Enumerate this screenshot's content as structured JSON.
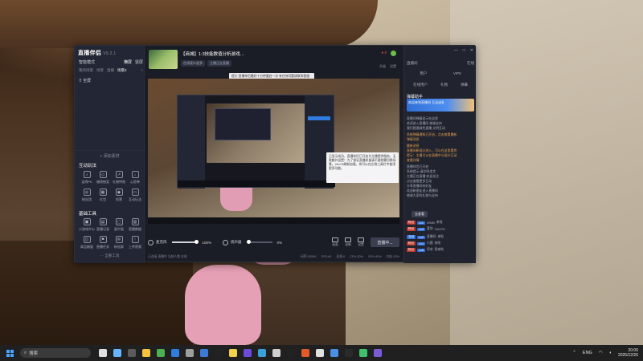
{
  "app": {
    "name": "直播伴侣",
    "version": "V9.2.1",
    "mode": "智能模式",
    "mode_right": "横屏",
    "mode_right2": "竖屏",
    "tabs": [
      "我的场景",
      "场景",
      "直播",
      "场景2"
    ],
    "add_tab": "+",
    "scene_item": "全屏",
    "add_source": "添加素材",
    "interaction_title": "互动玩法",
    "interaction_tools": [
      {
        "icon": "mic-icon",
        "label": "连线PK"
      },
      {
        "icon": "shield-icon",
        "label": "福袋抽奖"
      },
      {
        "icon": "rocket-icon",
        "label": "礼物特效"
      },
      {
        "icon": "download-icon",
        "label": "心愿单"
      },
      {
        "icon": "cup-icon",
        "label": "粉丝团"
      },
      {
        "icon": "grid-icon",
        "label": "红包"
      },
      {
        "icon": "target-icon",
        "label": "投票"
      },
      {
        "icon": "tv-icon",
        "label": "互动玩法"
      }
    ],
    "basic_title": "基础工具",
    "basic_tools": [
      {
        "icon": "gift-icon",
        "label": "小游戏中心"
      },
      {
        "icon": "doc-icon",
        "label": "直播记录"
      },
      {
        "icon": "pip-icon",
        "label": "画中画"
      },
      {
        "icon": "chart-icon",
        "label": "直播数据"
      },
      {
        "icon": "cart-icon",
        "label": "商品橱窗"
      },
      {
        "icon": "flag-icon",
        "label": "直播任务"
      },
      {
        "icon": "mail-icon",
        "label": "粉丝群"
      },
      {
        "icon": "upload-icon",
        "label": "上传视频"
      }
    ],
    "more_tools": "全部工具"
  },
  "stream": {
    "title": "【商城】1:3技能数值分析游戏…",
    "tags": [
      "在线观众超多",
      "主播正在直播"
    ],
    "user_links": [
      "升级",
      "设置"
    ],
    "notice": "8",
    "stats": [
      "流畅",
      "GPU",
      "内存",
      "CPU"
    ],
    "tooltip": "提示 直播伴侣最好十分钟重启一次 有任何问题请联系客服"
  },
  "popup_text": "已显示成功，直播伴侣已开启为主播提供服务，无需额外设置！为了保证直播质量请不要频繁切换场景，Ctrl+R刷新加载，你可以在左侧工具栏中使用更多功能。",
  "controls": {
    "mic_label": "麦克风",
    "mic_value": "100%",
    "speaker_label": "扬声器",
    "speaker_value": "0%",
    "mini": [
      "画面",
      "录制",
      "设置"
    ],
    "live_button": "直播中..."
  },
  "status_bar": {
    "left": "已连接 直播中 当前人数 在线",
    "items": [
      "码率:3000K",
      "FPS:60",
      "丢帧:0",
      "CPU:20%",
      "GPU:40%",
      "内存:32%"
    ]
  },
  "right_panel": {
    "header_left": "直播间",
    "header_right": "在线",
    "window_controls": [
      "—",
      "□",
      "✕"
    ],
    "tabs1": [
      "用户",
      "VIP5"
    ],
    "tabs2": [
      "在线用户",
      "礼物",
      "弹幕"
    ],
    "title": "弹幕助手",
    "banner": "欢迎来到直播间 互动送礼",
    "lines": [
      "直播间弹幕显示在这里",
      "欢迎进入直播间 感谢支持",
      "我们提倡绿色直播 文明互动",
      "直播伴侣已开启",
      "系统提示:请文明发言",
      "主播正在直播 欢迎关注",
      "点击查看更多互动",
      "分享直播间给好友",
      "欢迎新朋友进入直播间",
      "感谢大家的礼物与支持"
    ],
    "highlight_lines": [
      "系统弹幕通知已开启，点击查看最新",
      "弹幕消息",
      "最新消息",
      "直播间新观众进入，可以在这里看到",
      "提示：主播可以在直播中与观众互动",
      "查看详情"
    ],
    "button": "去查看",
    "chats": [
      {
        "badge": "粉丝",
        "badge_color": "#c0392b",
        "level": "Lv1",
        "name": "WMM",
        "text": "来啦"
      },
      {
        "badge": "粉丝",
        "badge_color": "#c0392b",
        "level": "Lv3",
        "name": "爱你",
        "text": "GAGTK"
      },
      {
        "badge": "互动",
        "badge_color": "#2f6fd8",
        "level": "Lv2",
        "name": "直播间",
        "text": "来啦"
      },
      {
        "badge": "粉丝",
        "badge_color": "#c0392b",
        "level": "Lv1",
        "name": "小鹿",
        "text": "来啦"
      },
      {
        "badge": "粉丝",
        "badge_color": "#c0392b",
        "level": "Lv5",
        "name": "阿宅",
        "text": "我来啦"
      }
    ]
  },
  "taskbar": {
    "search": "搜索",
    "app_colors": [
      "#e0e0e0",
      "#6ab4ff",
      "#5b5b5b",
      "#f5c242",
      "#4caf50",
      "#2f7be0",
      "#9e9e9e",
      "#3d7ad6",
      "#222",
      "#f2d14b",
      "#6c4bd8",
      "#3aa0d8",
      "#cfcfcf",
      "#222",
      "#e05a2b",
      "#e0e0e0",
      "#4a90e2",
      "#2a2a2a",
      "#3ec26b",
      "#7c5cd6"
    ],
    "lang": "ENG",
    "time": "20:06",
    "date": "2025/12/26"
  }
}
